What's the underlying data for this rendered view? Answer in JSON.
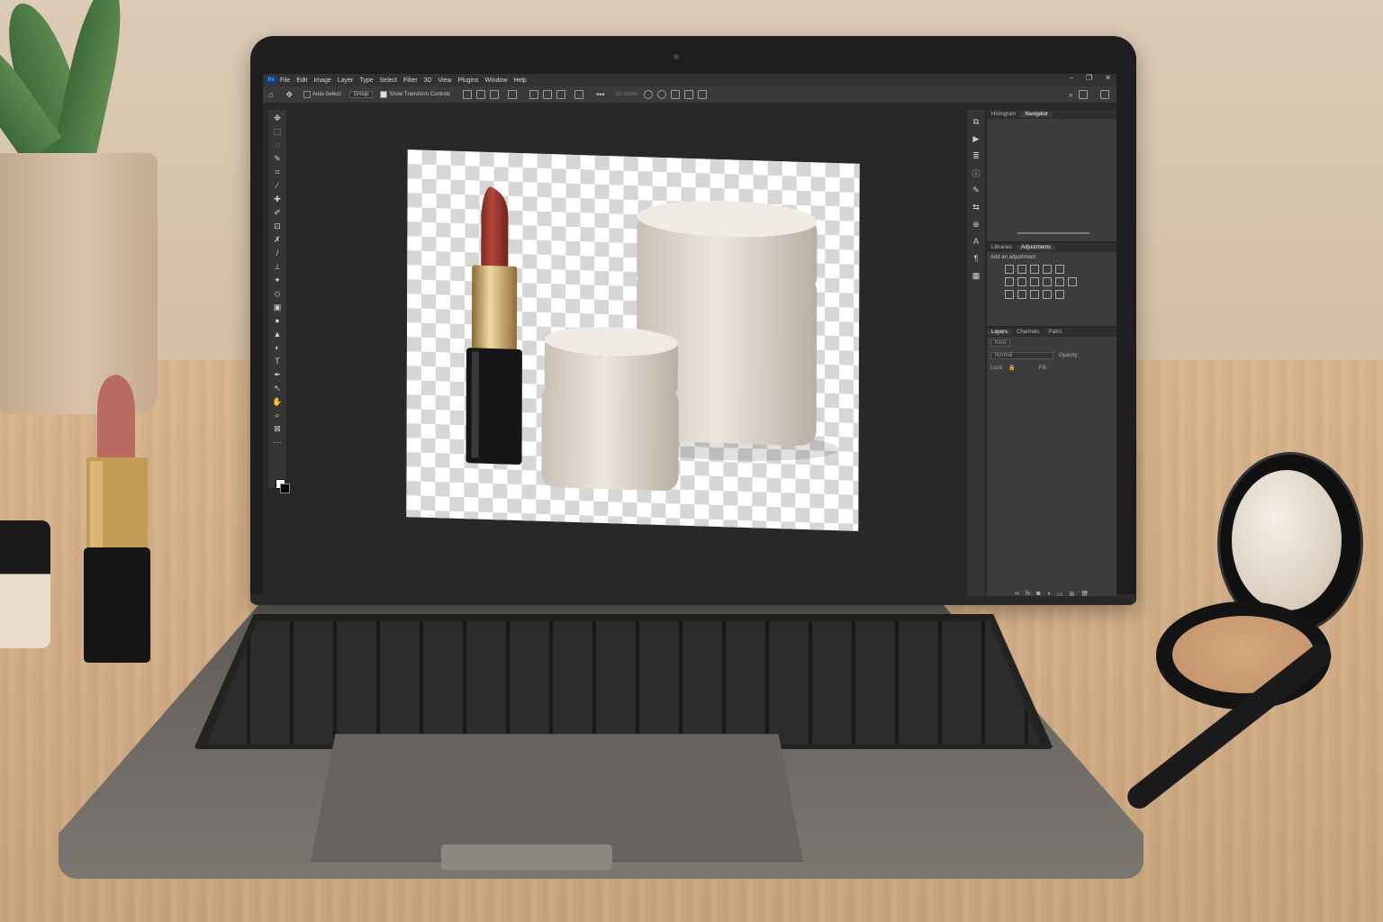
{
  "app": {
    "name": "Photoshop",
    "logo": "Ps",
    "menu": [
      "File",
      "Edit",
      "Image",
      "Layer",
      "Type",
      "Select",
      "Filter",
      "3D",
      "View",
      "Plugins",
      "Window",
      "Help"
    ],
    "window_controls": [
      "minimize-icon",
      "restore-icon",
      "close-icon"
    ]
  },
  "options_bar": {
    "auto_select_label": "Auto-Select:",
    "auto_select_value": "Group",
    "transform_label": "Show Transform Controls",
    "mode_label": "3D Mode:"
  },
  "panels": {
    "top_tabs": [
      "Histogram",
      "Navigator"
    ],
    "top_active": "Navigator",
    "mid_tabs": [
      "Libraries",
      "Adjustments"
    ],
    "mid_active": "Adjustments",
    "adjustments_label": "Add an adjustment",
    "layer_tabs": [
      "Layers",
      "Channels",
      "Paths"
    ],
    "layer_active": "Layers",
    "kind_placeholder": "Kind",
    "blend_mode": "Normal",
    "opacity_label": "Opacity:",
    "lock_label": "Lock:",
    "fill_label": "Fill:"
  },
  "colors": {
    "ps_bg": "#282828",
    "panel_bg": "#3c3c3c",
    "accent": "#31a8ff"
  }
}
